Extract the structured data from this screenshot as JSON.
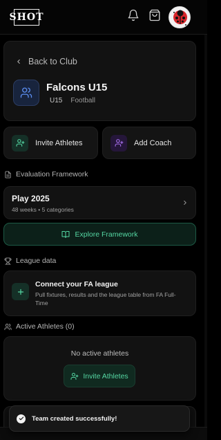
{
  "header": {
    "logo_text": "SHOT"
  },
  "hero": {
    "back_label": "Back to Club",
    "team_name": "Falcons U15",
    "age_group": "U15",
    "sport": "Football"
  },
  "actions": {
    "invite_label": "Invite Athletes",
    "coach_label": "Add Coach"
  },
  "evaluation": {
    "section_title": "Evaluation Framework",
    "framework_name": "Play 2025",
    "framework_meta": "48 weeks • 5 categories",
    "explore_label": "Explore Framework"
  },
  "league": {
    "section_title": "League data",
    "title": "Connect your FA league",
    "description": "Pull fixtures, results and the league table from FA Full-Time"
  },
  "athletes": {
    "section_title": "Active Athletes (0)",
    "empty_text": "No active athletes",
    "invite_label": "Invite Athletes"
  },
  "toast": {
    "message": "Team created successfully!"
  },
  "colors": {
    "accent_green": "#55d7a3",
    "accent_blue": "#5b8def",
    "accent_purple": "#a971f0",
    "background": "#000000",
    "card": "#121212"
  },
  "icons": {
    "notification": "bell-icon",
    "cart": "shopping-bag-icon",
    "team": "users-icon",
    "invite": "user-plus-icon",
    "coach": "user-plus-icon",
    "framework": "book-open-icon",
    "league": "plus-icon",
    "trophy": "trophy-icon",
    "toast": "check-circle-icon"
  }
}
